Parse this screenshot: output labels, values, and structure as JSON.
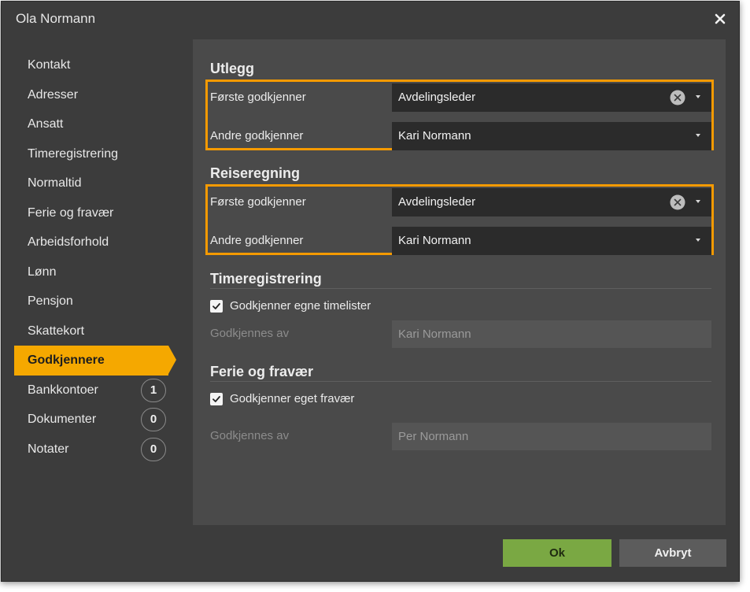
{
  "dialog": {
    "title": "Ola Normann"
  },
  "sidebar": {
    "items": [
      {
        "label": "Kontakt"
      },
      {
        "label": "Adresser"
      },
      {
        "label": "Ansatt"
      },
      {
        "label": "Timeregistrering"
      },
      {
        "label": "Normaltid"
      },
      {
        "label": "Ferie og fravær"
      },
      {
        "label": "Arbeidsforhold"
      },
      {
        "label": "Lønn"
      },
      {
        "label": "Pensjon"
      },
      {
        "label": "Skattekort"
      },
      {
        "label": "Godkjennere",
        "active": true
      },
      {
        "label": "Bankkontoer",
        "count": "1"
      },
      {
        "label": "Dokumenter",
        "count": "0"
      },
      {
        "label": "Notater",
        "count": "0"
      }
    ]
  },
  "utlegg": {
    "title": "Utlegg",
    "first_label": "Første godkjenner",
    "first_value": "Avdelingsleder",
    "second_label": "Andre godkjenner",
    "second_value": "Kari Normann"
  },
  "reiseregning": {
    "title": "Reiseregning",
    "first_label": "Første godkjenner",
    "first_value": "Avdelingsleder",
    "second_label": "Andre godkjenner",
    "second_value": "Kari Normann"
  },
  "timeregistrering": {
    "title": "Timeregistrering",
    "checkbox_label": "Godkjenner egne timelister",
    "checked": true,
    "approved_by_label": "Godkjennes av",
    "approved_by_value": "Kari Normann"
  },
  "ferie": {
    "title": "Ferie og fravær",
    "checkbox_label": "Godkjenner eget fravær",
    "checked": true,
    "approved_by_label": "Godkjennes av",
    "approved_by_value": "Per Normann"
  },
  "buttons": {
    "ok": "Ok",
    "cancel": "Avbryt"
  },
  "colors": {
    "accent": "#f5a800",
    "highlight_border": "#f59a00",
    "ok_button": "#7aa843"
  }
}
